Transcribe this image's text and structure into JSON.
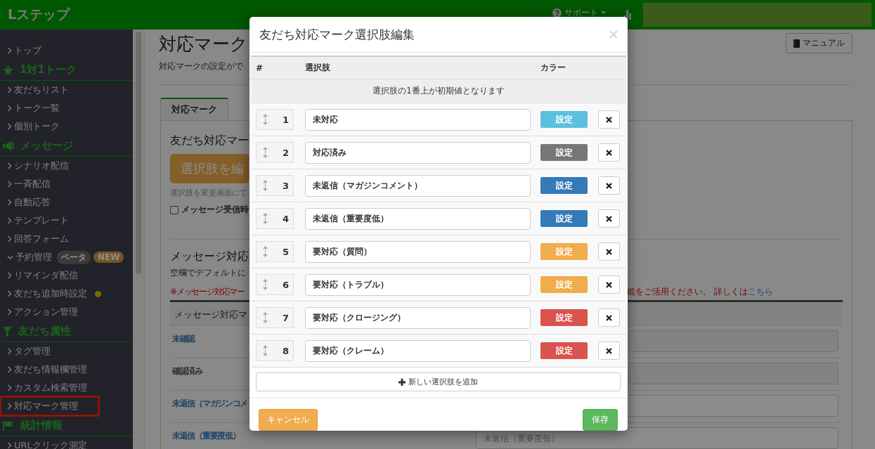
{
  "header": {
    "logo": "Lステップ",
    "support_menu": "サポート"
  },
  "sidebar": {
    "items": [
      {
        "kind": "link",
        "label": "トップ",
        "selected": false,
        "expanded": false,
        "notice": false
      },
      {
        "kind": "heading",
        "label": "1対1トーク"
      },
      {
        "kind": "link",
        "label": "友だちリスト",
        "selected": false,
        "expanded": false,
        "notice": false
      },
      {
        "kind": "link",
        "label": "トーク一覧",
        "selected": false,
        "expanded": false,
        "notice": false
      },
      {
        "kind": "link",
        "label": "個別トーク",
        "selected": false,
        "expanded": false,
        "notice": false
      },
      {
        "kind": "heading",
        "label": "メッセージ"
      },
      {
        "kind": "link",
        "label": "シナリオ配信",
        "selected": false,
        "expanded": false,
        "notice": false
      },
      {
        "kind": "link",
        "label": "一斉配信",
        "selected": false,
        "expanded": false,
        "notice": false
      },
      {
        "kind": "link",
        "label": "自動応答",
        "selected": false,
        "expanded": false,
        "notice": false
      },
      {
        "kind": "link",
        "label": "テンプレート",
        "selected": false,
        "expanded": false,
        "notice": false
      },
      {
        "kind": "link",
        "label": "回答フォーム",
        "selected": false,
        "expanded": false,
        "notice": false
      },
      {
        "kind": "link",
        "label": "予約管理",
        "selected": false,
        "expanded": true,
        "notice": false,
        "badges": [
          {
            "label": "ベータ",
            "kind": "muted"
          },
          {
            "label": "NEW",
            "kind": "accent"
          }
        ]
      },
      {
        "kind": "link",
        "label": "リマインダ配信",
        "selected": false,
        "expanded": false,
        "notice": false
      },
      {
        "kind": "link",
        "label": "友だち追加時設定",
        "selected": false,
        "expanded": false,
        "notice": true
      },
      {
        "kind": "link",
        "label": "アクション管理",
        "selected": false,
        "expanded": false,
        "notice": false
      },
      {
        "kind": "heading",
        "label": "友だち属性"
      },
      {
        "kind": "link",
        "label": "タグ管理",
        "selected": false,
        "expanded": false,
        "notice": false
      },
      {
        "kind": "link",
        "label": "友だち情報欄管理",
        "selected": false,
        "expanded": false,
        "notice": false
      },
      {
        "kind": "link",
        "label": "カスタム検索管理",
        "selected": false,
        "expanded": false,
        "notice": false
      },
      {
        "kind": "link",
        "label": "対応マーク管理",
        "selected": true,
        "expanded": false,
        "notice": false
      },
      {
        "kind": "heading",
        "label": "統計情報"
      },
      {
        "kind": "link",
        "label": "URLクリック測定",
        "selected": false,
        "expanded": false,
        "notice": false
      }
    ]
  },
  "page": {
    "title": "対応マーク",
    "description": "対応マークの設定がで",
    "manual_button": "マニュアル",
    "tabs": [
      {
        "label": "対応マーク",
        "selected": true
      }
    ],
    "friend_section": {
      "heading": "友だち対応マー",
      "edit_button": "選択肢を編",
      "hint": "選択肢を変更画面にて",
      "checkbox": {
        "label": "メッセージ受信時",
        "checked": false
      }
    },
    "message_section": {
      "heading": "メッセージ対応",
      "description": "空欄でデフォルトに",
      "warning": "※メッセージ対応マー",
      "warning_tail": "能をご活用ください。 詳しくは",
      "link": "こちら",
      "table": {
        "columns": [
          "メッセージ対応マ"
        ],
        "rows": [
          {
            "label": "未確認",
            "linked": true,
            "disabled": true
          },
          {
            "label": "確認済み",
            "linked": false,
            "disabled": true
          },
          {
            "label": "未返信（マガジンコメ",
            "linked": true,
            "disabled": false
          },
          {
            "label": "未返信（重要度低）",
            "linked": true,
            "disabled": false,
            "placeholder": "未返信（重要度低）"
          }
        ]
      }
    }
  },
  "modal": {
    "title": "友だち対応マーク選択肢編集",
    "columns": [
      "#",
      "選択肢",
      "カラー"
    ],
    "note": "選択肢の1番上が初期値となります",
    "options": [
      {
        "number": "1",
        "label": "未対応",
        "button": "設定",
        "color": "#5bc0de"
      },
      {
        "number": "2",
        "label": "対応済み",
        "button": "設定",
        "color": "#777777"
      },
      {
        "number": "3",
        "label": "未返信（マガジンコメント）",
        "button": "設定",
        "color": "#337ab7"
      },
      {
        "number": "4",
        "label": "未返信（重要度低）",
        "button": "設定",
        "color": "#337ab7"
      },
      {
        "number": "5",
        "label": "要対応（質問）",
        "button": "設定",
        "color": "#f0ad4e"
      },
      {
        "number": "6",
        "label": "要対応（トラブル）",
        "button": "設定",
        "color": "#f0ad4e"
      },
      {
        "number": "7",
        "label": "要対応（クロージング）",
        "button": "設定",
        "color": "#d9534f"
      },
      {
        "number": "8",
        "label": "要対応（クレーム）",
        "button": "設定",
        "color": "#d9534f"
      }
    ],
    "add_button": "新しい選択肢を追加",
    "cancel_button": "キャンセル",
    "save_button": "保存"
  }
}
